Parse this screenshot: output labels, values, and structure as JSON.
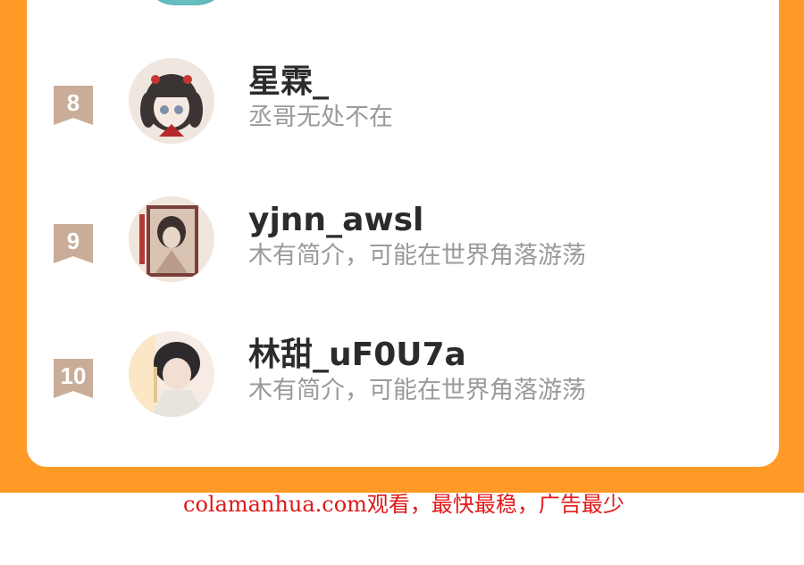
{
  "ranking": {
    "rows": [
      {
        "rank": "8",
        "name": "星霖_",
        "bio": "丞哥无处不在"
      },
      {
        "rank": "9",
        "name": "yjnn_awsl",
        "bio": "木有简介，可能在世界角落游荡"
      },
      {
        "rank": "10",
        "name": "林甜_uF0U7a",
        "bio": "木有简介，可能在世界角落游荡"
      }
    ]
  },
  "colors": {
    "background_accent": "#ff9a27",
    "rank_badge": "#c9ad98",
    "name_text": "#2b2b2b",
    "bio_text": "#9a9a9a",
    "ad_text": "#e01818"
  },
  "footer": {
    "ad_text": "colamanhua.com观看，最快最稳，广告最少"
  }
}
